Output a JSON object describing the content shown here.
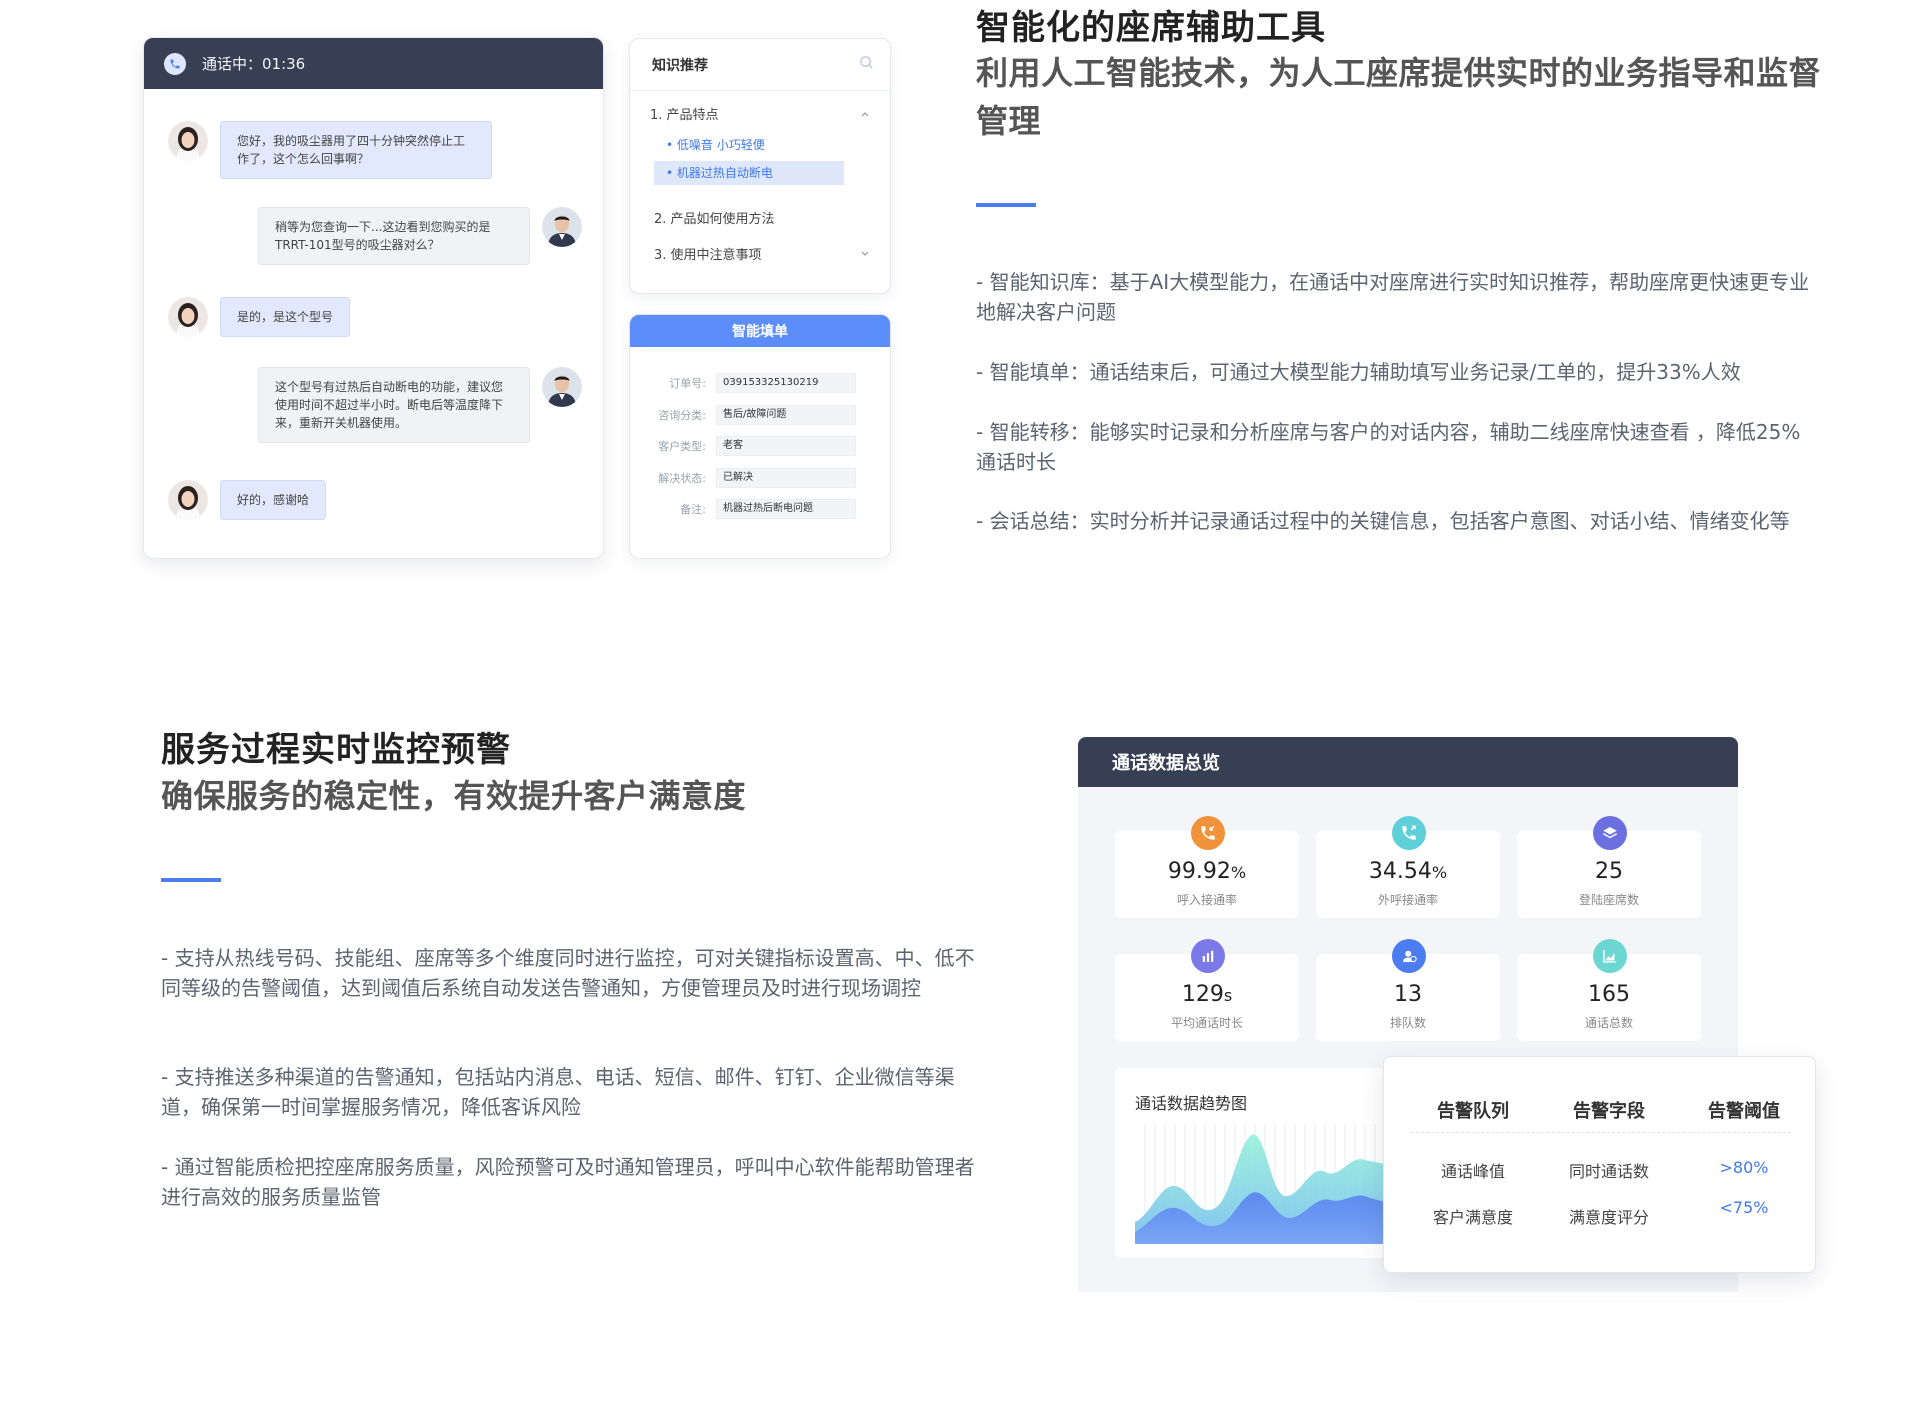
{
  "chat": {
    "status": "通话中：01:36",
    "messages": [
      {
        "role": "customer",
        "text": "您好，我的吸尘器用了四十分钟突然停止工作了，这个怎么回事啊？"
      },
      {
        "role": "agent",
        "text": "稍等为您查询一下...这边看到您购买的是TRRT-101型号的吸尘器对么？"
      },
      {
        "role": "customer",
        "text": "是的，是这个型号"
      },
      {
        "role": "agent",
        "text": "这个型号有过热后自动断电的功能，建议您使用时间不超过半小时。断电后等温度降下来，重新开关机器使用。"
      },
      {
        "role": "customer",
        "text": "好的，感谢哈"
      }
    ]
  },
  "knowledge": {
    "title": "知识推荐",
    "items": [
      {
        "label": "1. 产品特点",
        "sub": [
          "低噪音 小巧轻便",
          "机器过热自动断电"
        ]
      },
      {
        "label": "2. 产品如何使用方法"
      },
      {
        "label": "3. 使用中注意事项"
      }
    ]
  },
  "smart_form": {
    "title": "智能填单",
    "fields": [
      {
        "label": "订单号:",
        "value": "039153325130219"
      },
      {
        "label": "咨询分类:",
        "value": "售后/故障问题"
      },
      {
        "label": "客户类型:",
        "value": "老客"
      },
      {
        "label": "解决状态:",
        "value": "已解决"
      },
      {
        "label": "备注:",
        "value": "机器过热后断电问题"
      }
    ]
  },
  "section1": {
    "title": "智能化的座席辅助工具",
    "subtitle": "利用人工智能技术，为人工座席提供实时的业务指导和监督管理",
    "points": [
      "- 智能知识库：基于AI大模型能力，在通话中对座席进行实时知识推荐，帮助座席更快速更专业地解决客户问题",
      "- 智能填单：通话结束后，可通过大模型能力辅助填写业务记录/工单的，提升33%人效",
      "- 智能转移：能够实时记录和分析座席与客户的对话内容，辅助二线座席快速查看 ，降低25%通话时长",
      "- 会话总结：实时分析并记录通话过程中的关键信息，包括客户意图、对话小结、情绪变化等"
    ]
  },
  "section2": {
    "title": "服务过程实时监控预警",
    "subtitle": "确保服务的稳定性，有效提升客户满意度",
    "points": [
      "- 支持从热线号码、技能组、座席等多个维度同时进行监控，可对关键指标设置高、中、低不同等级的告警阈值，达到阈值后系统自动发送告警通知，方便管理员及时进行现场调控",
      "- 支持推送多种渠道的告警通知，包括站内消息、电话、短信、邮件、钉钉、企业微信等渠道，确保第一时间掌握服务情况，降低客诉风险",
      "- 通过智能质检把控座席服务质量，风险预警可及时通知管理员，呼叫中心软件能帮助管理者进行高效的服务质量监管"
    ]
  },
  "dashboard": {
    "title": "通话数据总览",
    "stats": [
      {
        "value": "99.92",
        "unit": "%",
        "label": "呼入接通率",
        "icon": "phone-incoming-icon",
        "color": "#f0923a"
      },
      {
        "value": "34.54",
        "unit": "%",
        "label": "外呼接通率",
        "icon": "phone-outgoing-icon",
        "color": "#5fd0d8"
      },
      {
        "value": "25",
        "unit": "",
        "label": "登陆座席数",
        "icon": "layers-icon",
        "color": "#6c6fe0"
      },
      {
        "value": "129",
        "unit": "s",
        "label": "平均通话时长",
        "icon": "bar-chart-icon",
        "color": "#7b78e8"
      },
      {
        "value": "13",
        "unit": "",
        "label": "排队数",
        "icon": "queue-user-icon",
        "color": "#4c7df0"
      },
      {
        "value": "165",
        "unit": "",
        "label": "通话总数",
        "icon": "area-chart-icon",
        "color": "#6cd7d2"
      }
    ],
    "trend_title": "通话数据趋势图",
    "alert_table": {
      "headers": [
        "告警队列",
        "告警字段",
        "告警阈值"
      ],
      "rows": [
        [
          "通话峰值",
          "同时通话数",
          ">80%"
        ],
        [
          "客户满意度",
          "满意度评分",
          "<75%"
        ]
      ]
    }
  }
}
